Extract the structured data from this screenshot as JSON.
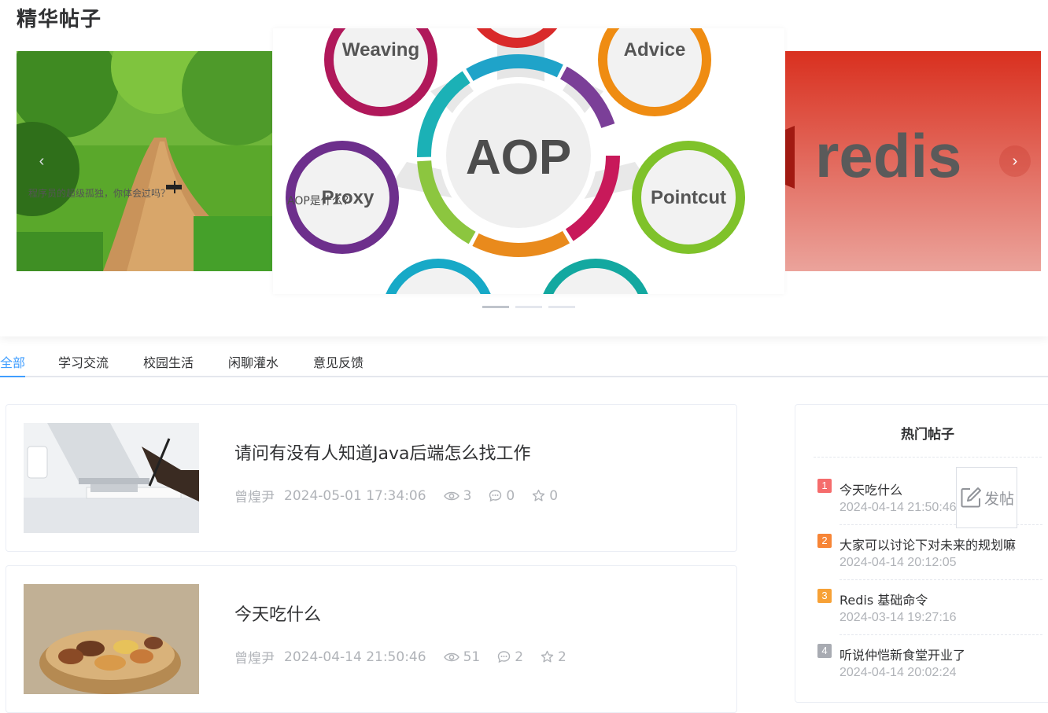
{
  "featured": {
    "title": "精华帖子",
    "slides": [
      {
        "caption": "程序员的超级孤独，你体会过吗？"
      },
      {
        "caption": "AOP是什么？",
        "diagram": {
          "center": "AOP",
          "nodes": [
            "Weaving",
            "Advice",
            "Proxy",
            "Pointcut"
          ]
        }
      },
      {
        "caption": "redis"
      }
    ],
    "indicator_count": 3,
    "active_indicator": 0
  },
  "tabs": [
    {
      "label": "全部",
      "active": true
    },
    {
      "label": "学习交流",
      "active": false
    },
    {
      "label": "校园生活",
      "active": false
    },
    {
      "label": "闲聊灌水",
      "active": false
    },
    {
      "label": "意见反馈",
      "active": false
    }
  ],
  "posts": [
    {
      "title": "请问有没有人知道Java后端怎么找工作",
      "author": "曾煌尹",
      "time": "2024-05-01 17:34:06",
      "views": "3",
      "comments": "0",
      "stars": "0"
    },
    {
      "title": "今天吃什么",
      "author": "曾煌尹",
      "time": "2024-04-14 21:50:46",
      "views": "51",
      "comments": "2",
      "stars": "2"
    }
  ],
  "hot": {
    "title": "热门帖子",
    "items": [
      {
        "rank": "1",
        "title": "今天吃什么",
        "time": "2024-04-14 21:50:46",
        "color": "#f56c6c"
      },
      {
        "rank": "2",
        "title": "大家可以讨论下对未来的规划嘛",
        "time": "2024-04-14 20:12:05",
        "color": "#f78536"
      },
      {
        "rank": "3",
        "title": "Redis 基础命令",
        "time": "2024-03-14 19:27:16",
        "color": "#f7a136"
      },
      {
        "rank": "4",
        "title": "听说仲恺新食堂开业了",
        "time": "2024-04-14 20:02:24",
        "color": "#a8abb2"
      }
    ]
  },
  "post_button": {
    "label": "发帖",
    "icon": "edit-icon"
  },
  "colors": {
    "accent": "#409eff",
    "muted": "#b0b3b8"
  }
}
